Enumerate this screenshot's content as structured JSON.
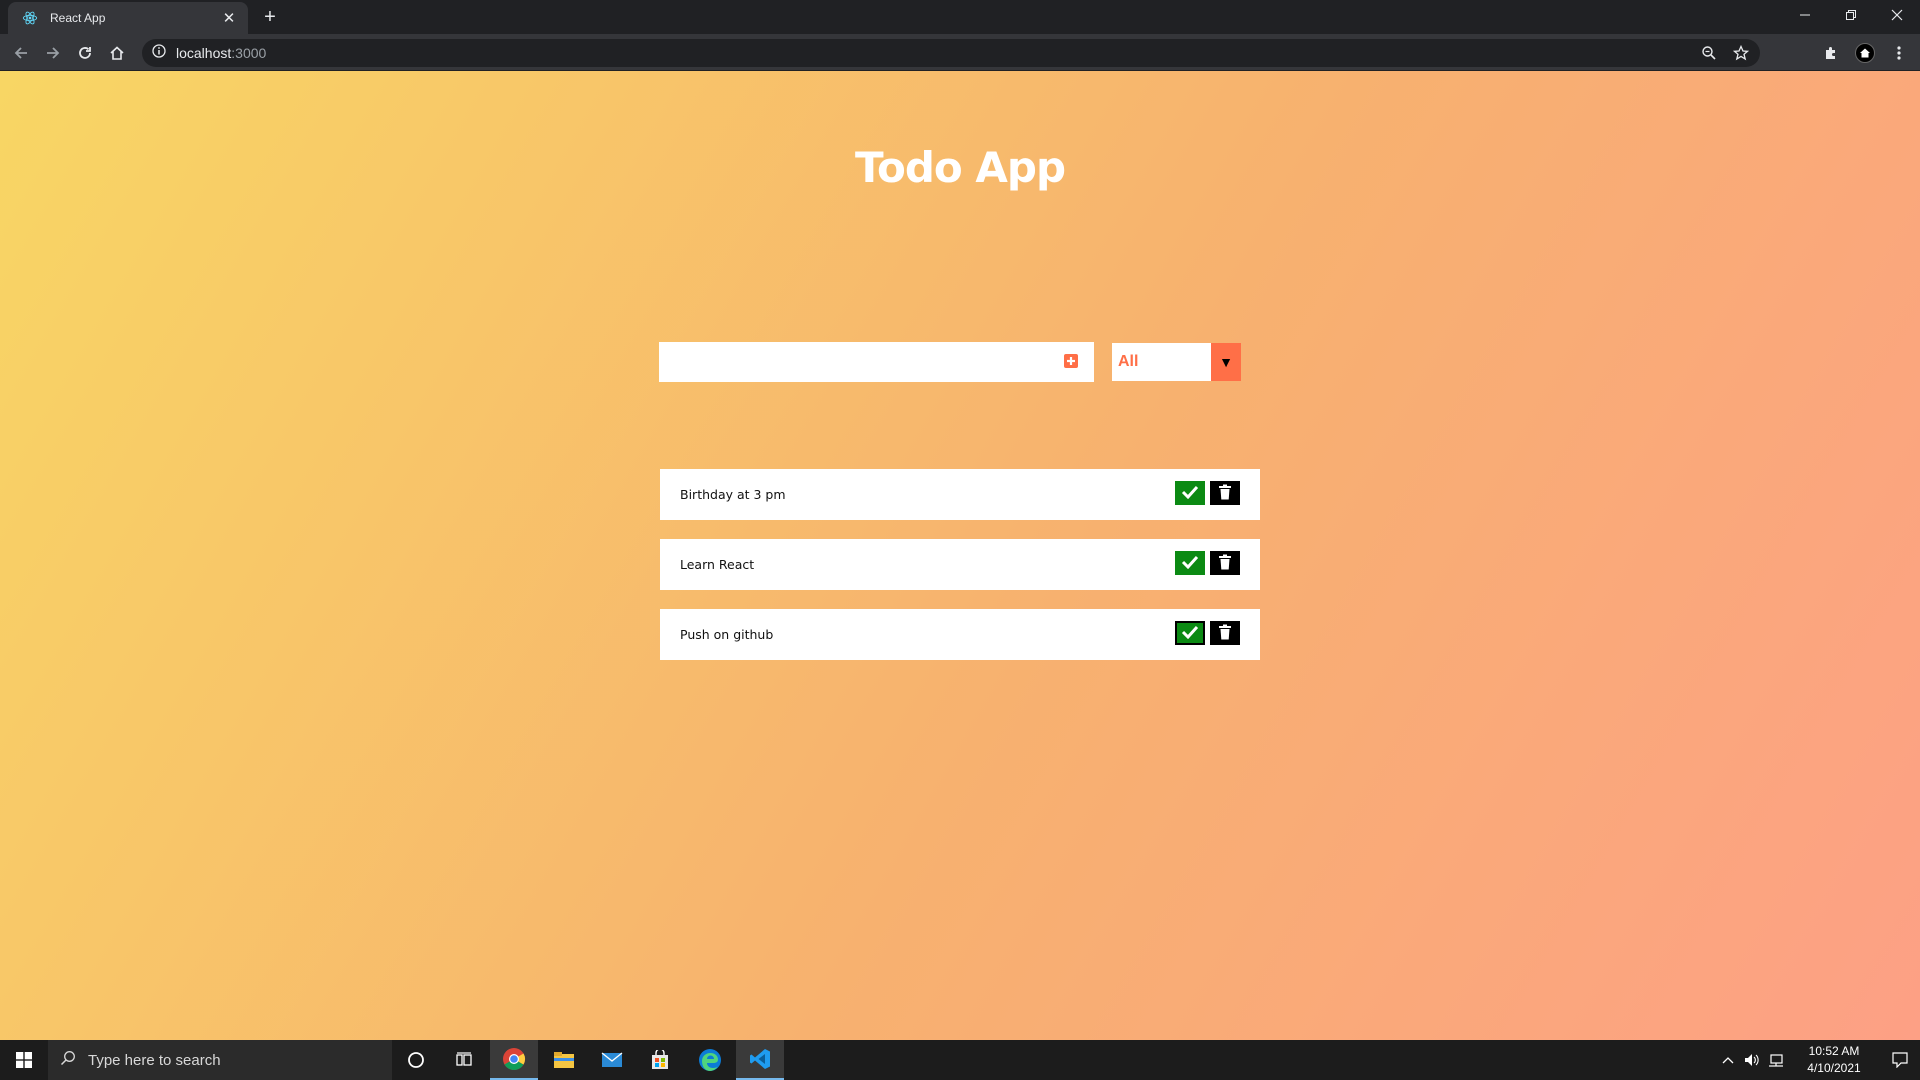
{
  "browser": {
    "tab_title": "React App",
    "tab_close_glyph": "✕",
    "new_tab_glyph": "+",
    "url_host": "localhost",
    "url_port": ":3000"
  },
  "app": {
    "title": "Todo App",
    "input": {
      "value": "",
      "placeholder": ""
    },
    "filter": {
      "selected": "All",
      "arrow_glyph": "▼"
    },
    "todos": [
      {
        "text": "Birthday at 3 pm",
        "focused": false
      },
      {
        "text": "Learn React",
        "focused": false
      },
      {
        "text": "Push on github",
        "focused": true
      }
    ]
  },
  "colors": {
    "gradient_start": "#f8d664",
    "gradient_end": "#fda085",
    "accent": "#ff6f47",
    "complete_green": "#0b8a13",
    "trash_black": "#000000"
  },
  "taskbar": {
    "search_placeholder": "Type here to search",
    "time": "10:52 AM",
    "date": "4/10/2021",
    "apps": [
      "cortana-icon",
      "task-view-icon",
      "chrome-icon",
      "file-explorer-icon",
      "mail-icon",
      "store-icon",
      "edge-icon",
      "vscode-icon"
    ]
  }
}
